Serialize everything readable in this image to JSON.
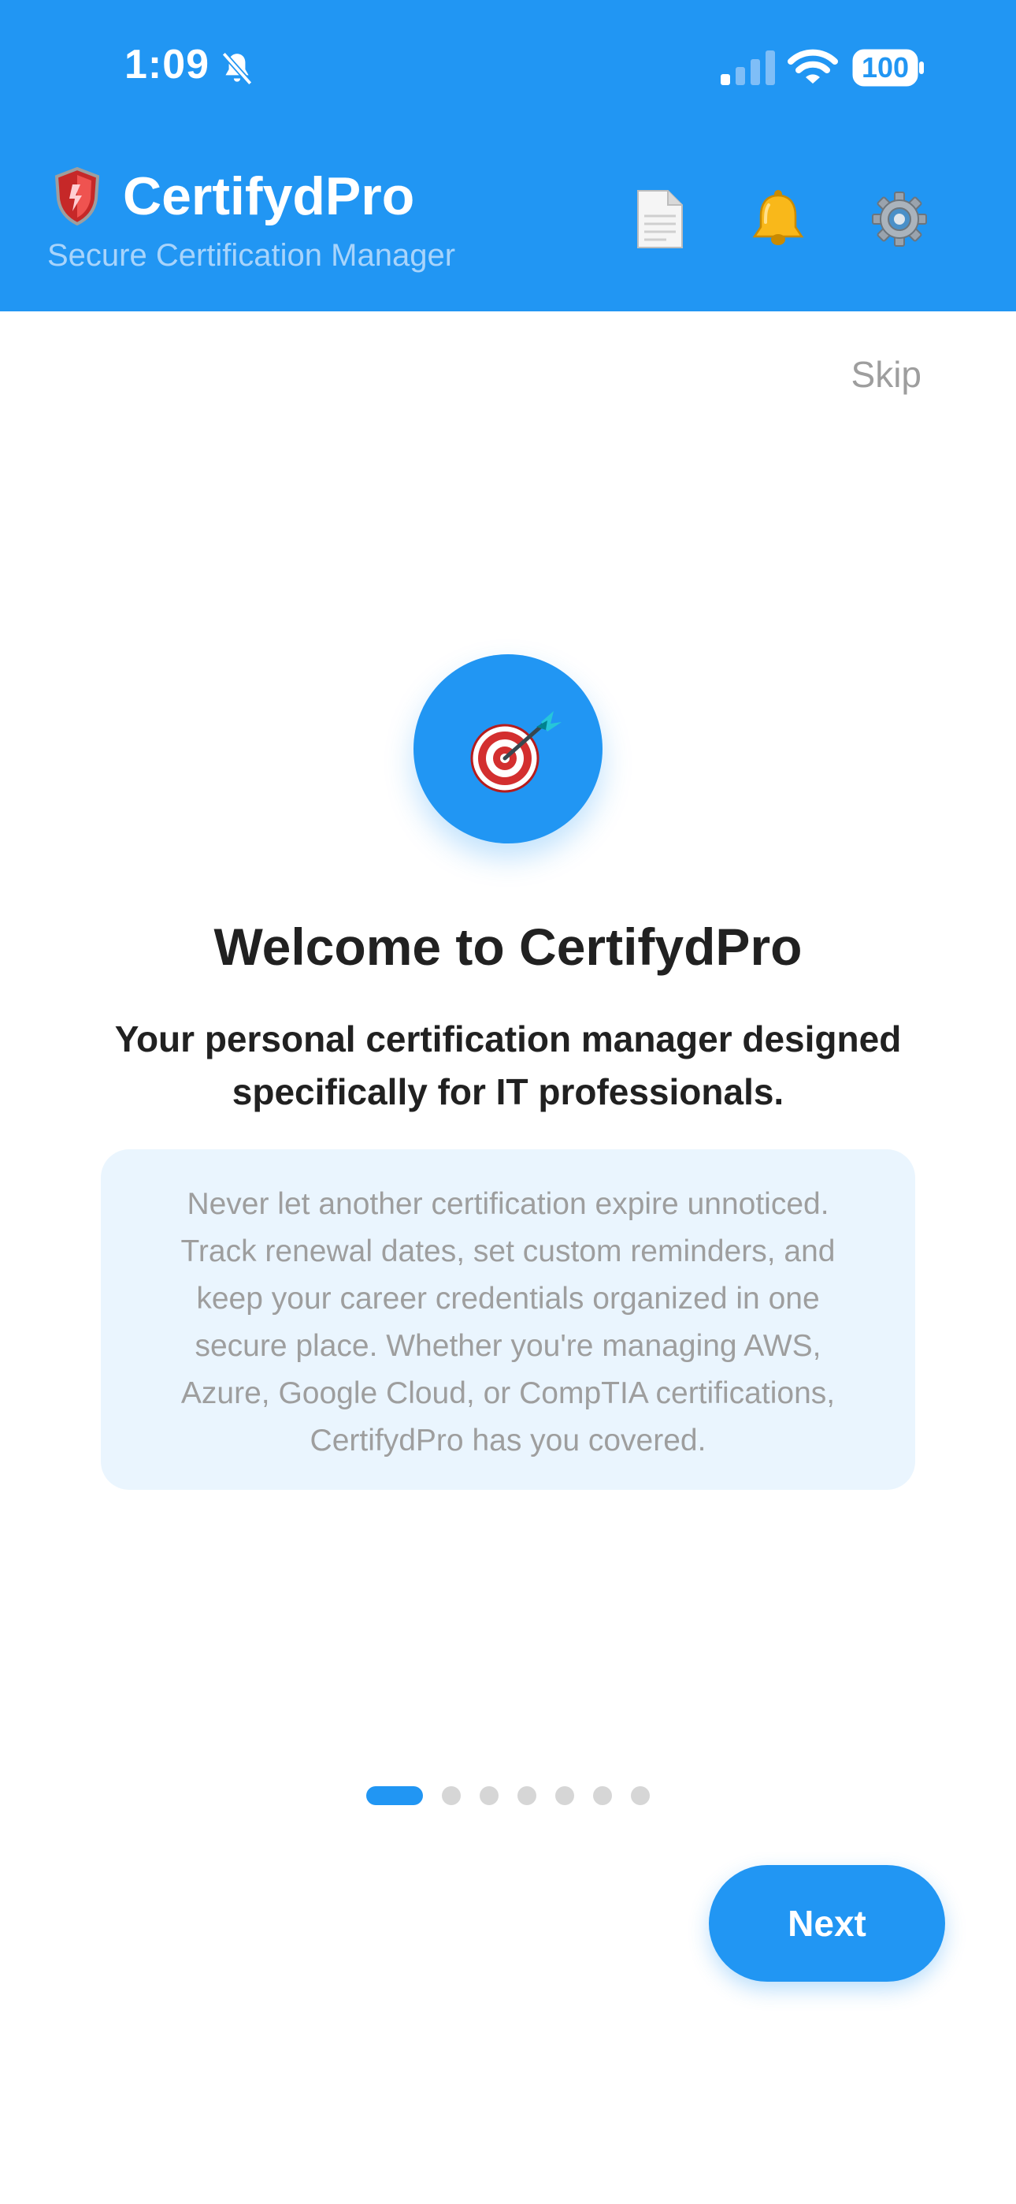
{
  "status_bar": {
    "time": "1:09",
    "battery": "100",
    "icons": [
      "bell-slash-icon",
      "cellular-signal-icon",
      "wifi-icon",
      "battery-icon"
    ]
  },
  "header": {
    "title": "CertifydPro",
    "subtitle": "Secure Certification Manager",
    "icons": [
      "shield-icon",
      "document-icon",
      "bell-icon",
      "gear-icon"
    ]
  },
  "onboarding": {
    "skip_label": "Skip",
    "hero_icon": "dart-target-icon",
    "title": "Welcome to CertifydPro",
    "subtitle": "Your personal certification manager designed specifically for IT professionals.",
    "description": "Never let another certification expire unnoticed. Track renewal dates, set custom reminders, and keep your career credentials organized in one secure place. Whether you're managing AWS, Azure, Google Cloud, or CompTIA certifications, CertifydPro has you covered.",
    "page_indicator": {
      "current": 1,
      "total": 7
    },
    "next_label": "Next"
  },
  "colors": {
    "primary": "#2196F3",
    "subtitle_text": "#a8d4fb",
    "muted_text": "#9e9e9e",
    "desc_background": "#EAF5FE",
    "dark_text": "#212121"
  }
}
